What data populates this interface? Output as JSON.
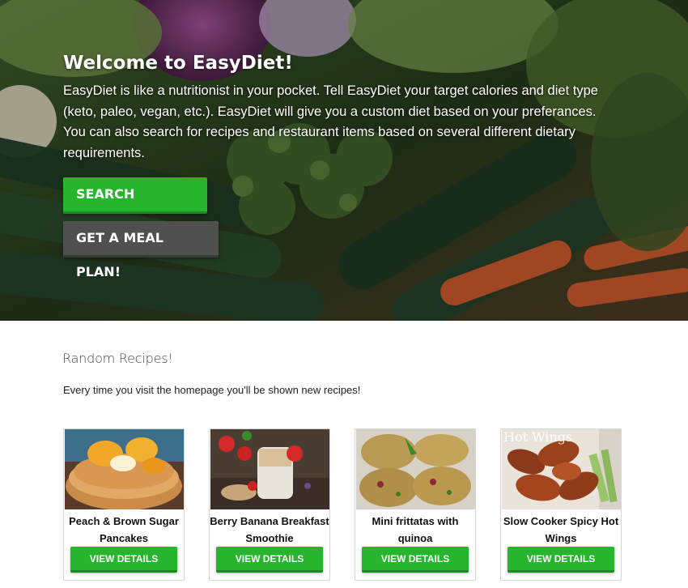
{
  "hero": {
    "title": "Welcome to EasyDiet!",
    "description": "EasyDiet is like a nutritionist in your pocket. Tell EasyDiet your target calories and diet type (keto, paleo, vegan, etc.). EasyDiet will give you a custom diet based on your preferances. You can also search for recipes and restaurant items based on several different dietary requirements.",
    "search_button": "SEARCH RECIPES!",
    "meal_plan_button": "GET A MEAL PLAN!"
  },
  "recipes_section": {
    "title": "Random Recipes!",
    "subtitle": "Every time you visit the homepage you'll be shown new recipes!",
    "cards": [
      {
        "title": "Peach & Brown Sugar Pancakes",
        "button": "VIEW DETAILS"
      },
      {
        "title": "Berry Banana Breakfast Smoothie",
        "button": "VIEW DETAILS"
      },
      {
        "title": "Mini frittatas with quinoa",
        "button": "VIEW DETAILS"
      },
      {
        "title": "Slow Cooker Spicy Hot Wings",
        "button": "VIEW DETAILS",
        "image_text": "Hot Wings"
      }
    ]
  },
  "colors": {
    "primary_green": "#27b52e",
    "secondary_gray": "#505050"
  }
}
